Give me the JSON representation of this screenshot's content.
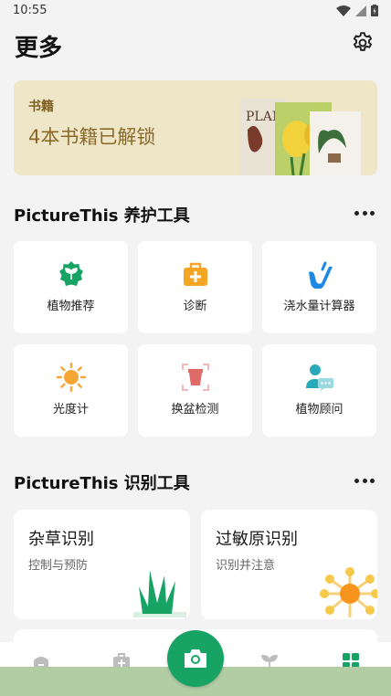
{
  "status": {
    "time": "10:55"
  },
  "header": {
    "title": "更多"
  },
  "books": {
    "label": "书籍",
    "text": "4本书籍已解锁",
    "cover_title": "PLAN"
  },
  "care": {
    "title": "PictureThis 养护工具",
    "tools": [
      {
        "label": "植物推荐",
        "icon": "plant-badge-icon",
        "color": "#17a364"
      },
      {
        "label": "诊断",
        "icon": "first-aid-kit-icon",
        "color": "#f5a524"
      },
      {
        "label": "浇水量计算器",
        "icon": "watering-icon",
        "color": "#1e88e5"
      },
      {
        "label": "光度计",
        "icon": "sun-icon",
        "color": "#f7a535"
      },
      {
        "label": "换盆检测",
        "icon": "pot-icon",
        "color": "#e06a68"
      },
      {
        "label": "植物顾问",
        "icon": "consultant-chat-icon",
        "color": "#27a9b8"
      }
    ]
  },
  "identify": {
    "title": "PictureThis 识别工具",
    "tools": [
      {
        "title": "杂草识别",
        "subtitle": "控制与预防",
        "icon": "grass-icon"
      },
      {
        "title": "过敏原识别",
        "subtitle": "识别并注意",
        "icon": "allergen-flower-icon"
      }
    ]
  },
  "nav": {
    "items": [
      "home-icon",
      "care-kit-icon",
      "camera-icon",
      "my-plants-icon",
      "more-grid-icon"
    ],
    "accent": "#17a364"
  }
}
